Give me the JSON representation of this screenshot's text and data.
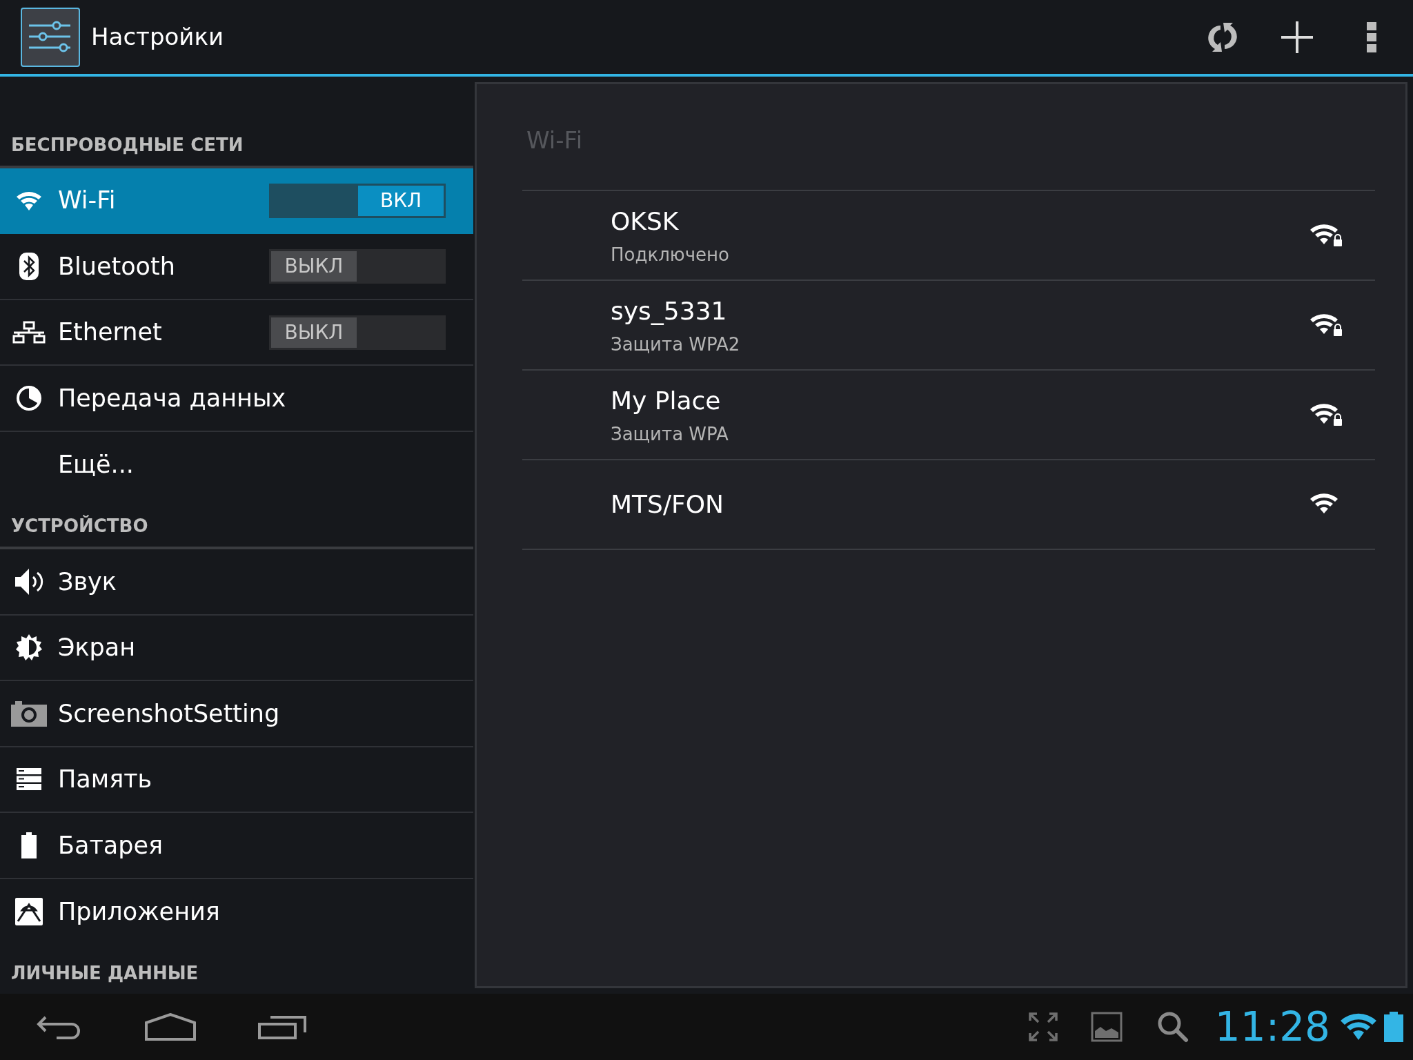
{
  "action_bar": {
    "title": "Настройки"
  },
  "sidebar": {
    "sections": [
      {
        "title": "БЕСПРОВОДНЫЕ СЕТИ",
        "items": [
          {
            "label": "Wi-Fi",
            "selected": true,
            "toggle": {
              "label": "ВКЛ",
              "on": true
            }
          },
          {
            "label": "Bluetooth",
            "selected": false,
            "toggle": {
              "label": "ВЫКЛ",
              "on": false
            }
          },
          {
            "label": "Ethernet",
            "selected": false,
            "toggle": {
              "label": "ВЫКЛ",
              "on": false
            }
          },
          {
            "label": "Передача данных",
            "selected": false
          },
          {
            "label": "Ещё...",
            "selected": false
          }
        ]
      },
      {
        "title": "УСТРОЙСТВО",
        "items": [
          {
            "label": "Звук",
            "selected": false
          },
          {
            "label": "Экран",
            "selected": false
          },
          {
            "label": "ScreenshotSetting",
            "selected": false
          },
          {
            "label": "Память",
            "selected": false
          },
          {
            "label": "Батарея",
            "selected": false
          },
          {
            "label": "Приложения",
            "selected": false
          }
        ]
      },
      {
        "title": "ЛИЧНЫЕ ДАННЫЕ"
      }
    ]
  },
  "wifi_panel": {
    "title": "Wi-Fi",
    "networks": [
      {
        "name": "OKSK",
        "status": "Подключено",
        "secured": true
      },
      {
        "name": "sys_5331",
        "status": "Защита WPA2",
        "secured": true
      },
      {
        "name": "My Place",
        "status": "Защита WPA",
        "secured": true
      },
      {
        "name": "MTS/FON",
        "secured": false
      }
    ]
  },
  "status_bar": {
    "time": "11:28"
  }
}
